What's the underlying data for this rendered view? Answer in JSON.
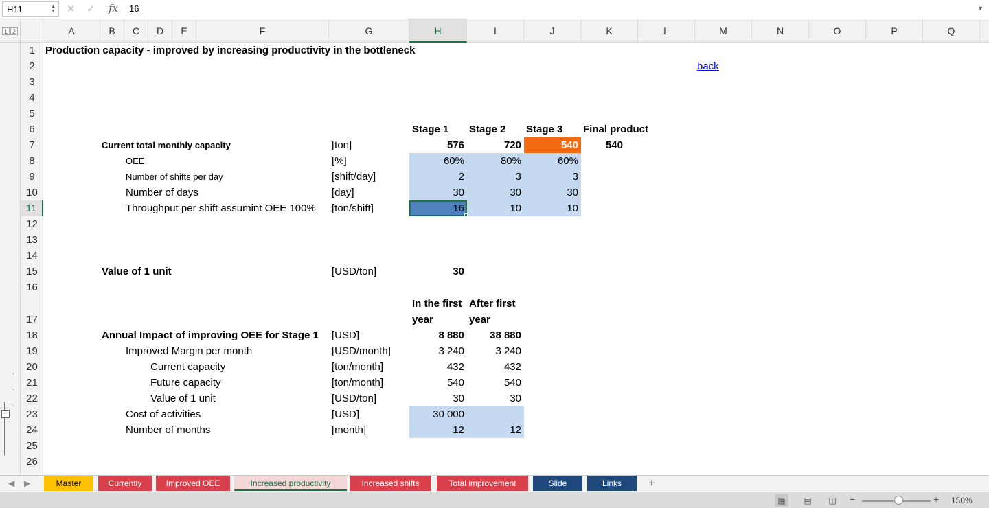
{
  "formula_bar": {
    "name_box": "H11",
    "fx": "fx",
    "value": "16"
  },
  "outline_levels": [
    "1",
    "2"
  ],
  "columns": [
    "A",
    "B",
    "C",
    "D",
    "E",
    "F",
    "G",
    "H",
    "I",
    "J",
    "K",
    "L",
    "M",
    "N",
    "O",
    "P",
    "Q"
  ],
  "rows": [
    "1",
    "2",
    "3",
    "4",
    "5",
    "6",
    "7",
    "8",
    "9",
    "10",
    "11",
    "12",
    "13",
    "14",
    "15",
    "16",
    "17",
    "18",
    "19",
    "20",
    "21",
    "22",
    "23",
    "24",
    "25",
    "26"
  ],
  "cells": {
    "title": "Production capacity - improved by increasing productivity in the bottleneck",
    "back_link": "back",
    "hdr_stage1": "Stage 1",
    "hdr_stage2": "Stage 2",
    "hdr_stage3": "Stage 3",
    "hdr_final": "Final product",
    "r7_label": "Current total monthly capacity",
    "r7_unit": "[ton]",
    "r7_h": "576",
    "r7_i": "720",
    "r7_j": "540",
    "r7_k": "540",
    "r8_label": "OEE",
    "r8_unit": "[%]",
    "r8_h": "60%",
    "r8_i": "80%",
    "r8_j": "60%",
    "r9_label": "Number of shifts per day",
    "r9_unit": "[shift/day]",
    "r9_h": "2",
    "r9_i": "3",
    "r9_j": "3",
    "r10_label": "Number of days",
    "r10_unit": "[day]",
    "r10_h": "30",
    "r10_i": "30",
    "r10_j": "30",
    "r11_label": "Throughput per shift assumint OEE 100%",
    "r11_unit": "[ton/shift]",
    "r11_h": "16",
    "r11_i": "10",
    "r11_j": "10",
    "r15_label": "Value of 1 unit",
    "r15_unit": "[USD/ton]",
    "r15_h": "30",
    "r17_h_line1": "In the first",
    "r17_h_line2": "year",
    "r17_i_line1": "After first",
    "r17_i_line2": "year",
    "r18_label": "Annual Impact of improving OEE for Stage 1",
    "r18_unit": "[USD]",
    "r18_h": "8 880",
    "r18_i": "38 880",
    "r19_label": "Improved Margin per month",
    "r19_unit": "[USD/month]",
    "r19_h": "3 240",
    "r19_i": "3 240",
    "r20_label": "Current capacity",
    "r20_unit": "[ton/month]",
    "r20_h": "432",
    "r20_i": "432",
    "r21_label": "Future capacity",
    "r21_unit": "[ton/month]",
    "r21_h": "540",
    "r21_i": "540",
    "r22_label": "Value of 1 unit",
    "r22_unit": "[USD/ton]",
    "r22_h": "30",
    "r22_i": "30",
    "r23_label": "Cost of activities",
    "r23_unit": "[USD]",
    "r23_h": "30 000",
    "r24_label": "Number of months",
    "r24_unit": "[month]",
    "r24_h": "12",
    "r24_i": "12"
  },
  "tabs": [
    {
      "label": "Master",
      "color": "#ffc000",
      "text": "#000000"
    },
    {
      "label": "Currently",
      "color": "#d9404c",
      "text": "#ffffff"
    },
    {
      "label": "Improved OEE",
      "color": "#d9404c",
      "text": "#ffffff"
    },
    {
      "label": "Increased productivity",
      "color": "#f3d6d6",
      "text": "#1e7145"
    },
    {
      "label": "Increased shifts",
      "color": "#d9404c",
      "text": "#ffffff"
    },
    {
      "label": "Total improvement",
      "color": "#d9404c",
      "text": "#ffffff"
    },
    {
      "label": "Slide",
      "color": "#1f497d",
      "text": "#ffffff"
    },
    {
      "label": "Links",
      "color": "#1f497d",
      "text": "#ffffff"
    }
  ],
  "add_tab": "+",
  "status": {
    "zoom": "150%",
    "zoom_minus": "−",
    "zoom_plus": "+"
  },
  "colors": {
    "fill_blue": "#c5d9f1",
    "bottleneck": "#f26a11",
    "selected": "#4f81bd",
    "excel_green": "#1e7145"
  }
}
